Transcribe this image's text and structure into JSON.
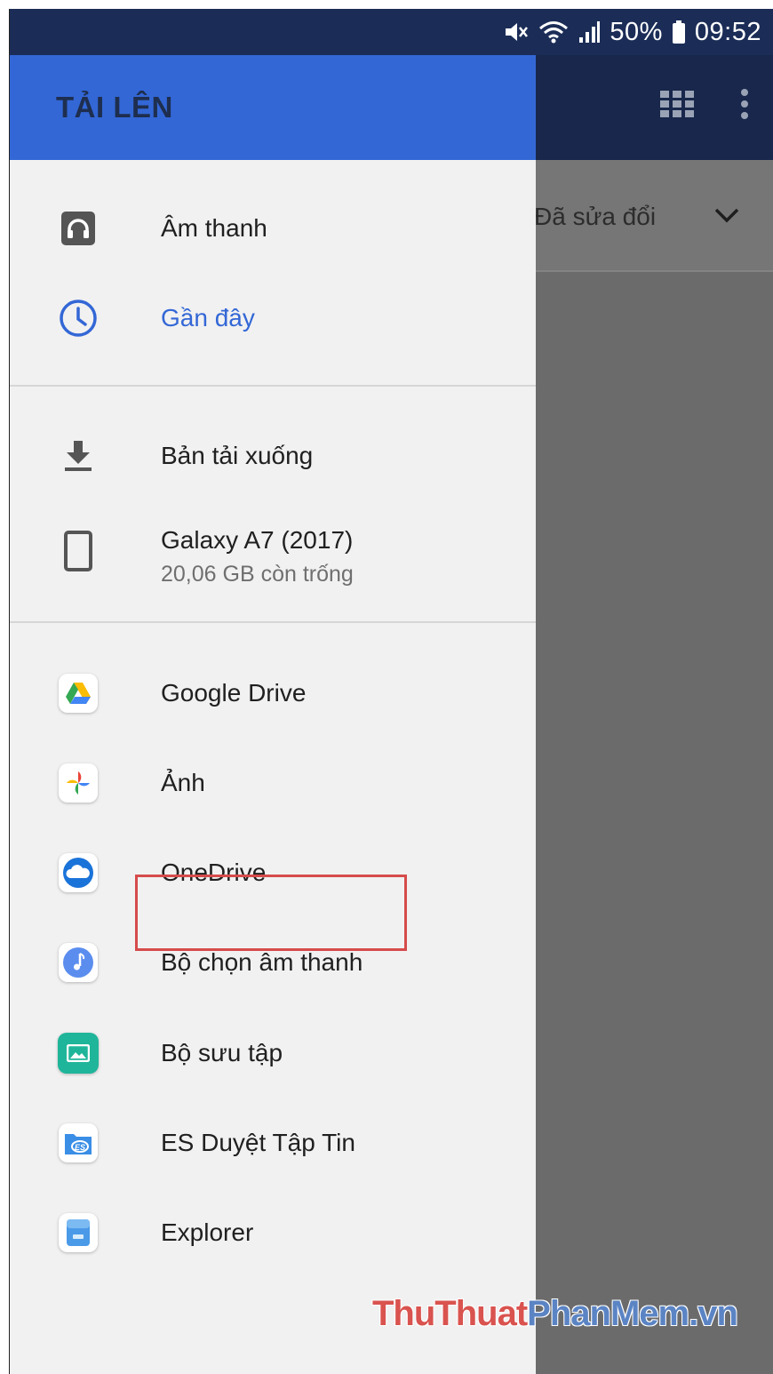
{
  "status_bar": {
    "battery": "50%",
    "time": "09:52"
  },
  "drawer": {
    "title": "TẢI LÊN",
    "section1": [
      {
        "label": "Âm thanh",
        "icon": "headphones-icon"
      },
      {
        "label": "Gần đây",
        "icon": "clock-icon",
        "selected": true
      }
    ],
    "section2": [
      {
        "label": "Bản tải xuống",
        "icon": "download-icon"
      },
      {
        "label": "Galaxy A7 (2017)",
        "sublabel": "20,06 GB còn trống",
        "icon": "phone-icon"
      }
    ],
    "section3": [
      {
        "label": "Google Drive",
        "icon": "google-drive-icon"
      },
      {
        "label": "Ảnh",
        "icon": "google-photos-icon"
      },
      {
        "label": "OneDrive",
        "icon": "onedrive-icon"
      },
      {
        "label": "Bộ chọn âm thanh",
        "icon": "music-note-icon",
        "highlighted": true
      },
      {
        "label": "Bộ sưu tập",
        "icon": "gallery-icon"
      },
      {
        "label": "ES Duyệt Tập Tin",
        "icon": "es-file-explorer-icon"
      },
      {
        "label": "Explorer",
        "icon": "explorer-icon"
      }
    ]
  },
  "background": {
    "sort_label": "Đã sửa đổi"
  },
  "watermark": {
    "part1": "ThuThuat",
    "part2": "PhanMem.vn"
  },
  "colors": {
    "accent": "#3367d6",
    "status_bar": "#1b2d57",
    "highlight_box": "#d64b4b"
  }
}
